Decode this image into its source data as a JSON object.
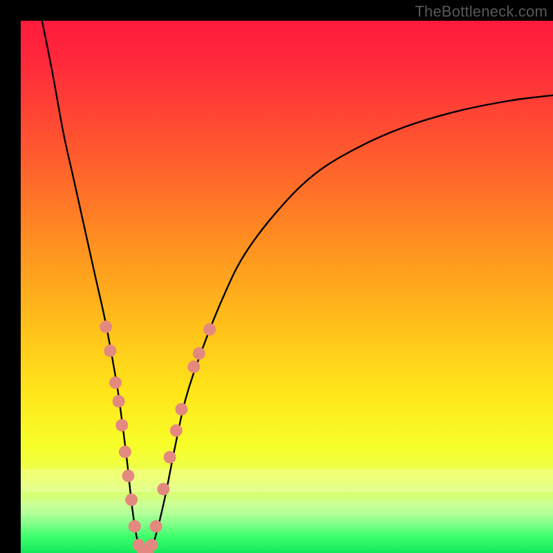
{
  "watermark": "TheBottleneck.com",
  "colors": {
    "frame": "#000000",
    "curve": "#000000",
    "dot_fill": "#e4897f",
    "dot_stroke": "#c86b5f",
    "gradient_top": "#ff1a3c",
    "gradient_bottom": "#12e85b"
  },
  "chart_data": {
    "type": "line",
    "title": "",
    "xlabel": "",
    "ylabel": "",
    "xlim": [
      0,
      100
    ],
    "ylim": [
      0,
      100
    ],
    "series": [
      {
        "name": "bottleneck-curve",
        "x": [
          4,
          6,
          8,
          10,
          12,
          14,
          16,
          18,
          19,
          20,
          21,
          22,
          23,
          24,
          25,
          27,
          29,
          31,
          34,
          38,
          42,
          48,
          55,
          63,
          72,
          82,
          92,
          100
        ],
        "y": [
          100,
          90,
          79,
          70,
          61,
          52,
          43,
          32,
          25,
          17,
          8,
          2,
          0,
          0,
          2,
          10,
          20,
          29,
          38,
          48,
          56,
          64,
          71,
          76,
          80,
          83,
          85,
          86
        ]
      }
    ],
    "highlight_dots": {
      "name": "salmon-dots",
      "points": [
        {
          "x": 16.0,
          "y": 42.5
        },
        {
          "x": 16.8,
          "y": 38.0
        },
        {
          "x": 17.8,
          "y": 32.0
        },
        {
          "x": 18.4,
          "y": 28.5
        },
        {
          "x": 19.0,
          "y": 24.0
        },
        {
          "x": 19.6,
          "y": 19.0
        },
        {
          "x": 20.2,
          "y": 14.5
        },
        {
          "x": 20.8,
          "y": 10.0
        },
        {
          "x": 21.4,
          "y": 5.0
        },
        {
          "x": 22.2,
          "y": 1.5
        },
        {
          "x": 23.0,
          "y": 0.2
        },
        {
          "x": 23.8,
          "y": 0.2
        },
        {
          "x": 24.6,
          "y": 1.5
        },
        {
          "x": 25.4,
          "y": 5.0
        },
        {
          "x": 26.8,
          "y": 12.0
        },
        {
          "x": 28.0,
          "y": 18.0
        },
        {
          "x": 29.2,
          "y": 23.0
        },
        {
          "x": 30.2,
          "y": 27.0
        },
        {
          "x": 32.5,
          "y": 35.0
        },
        {
          "x": 33.5,
          "y": 37.5
        },
        {
          "x": 35.5,
          "y": 42.0
        }
      ]
    }
  }
}
